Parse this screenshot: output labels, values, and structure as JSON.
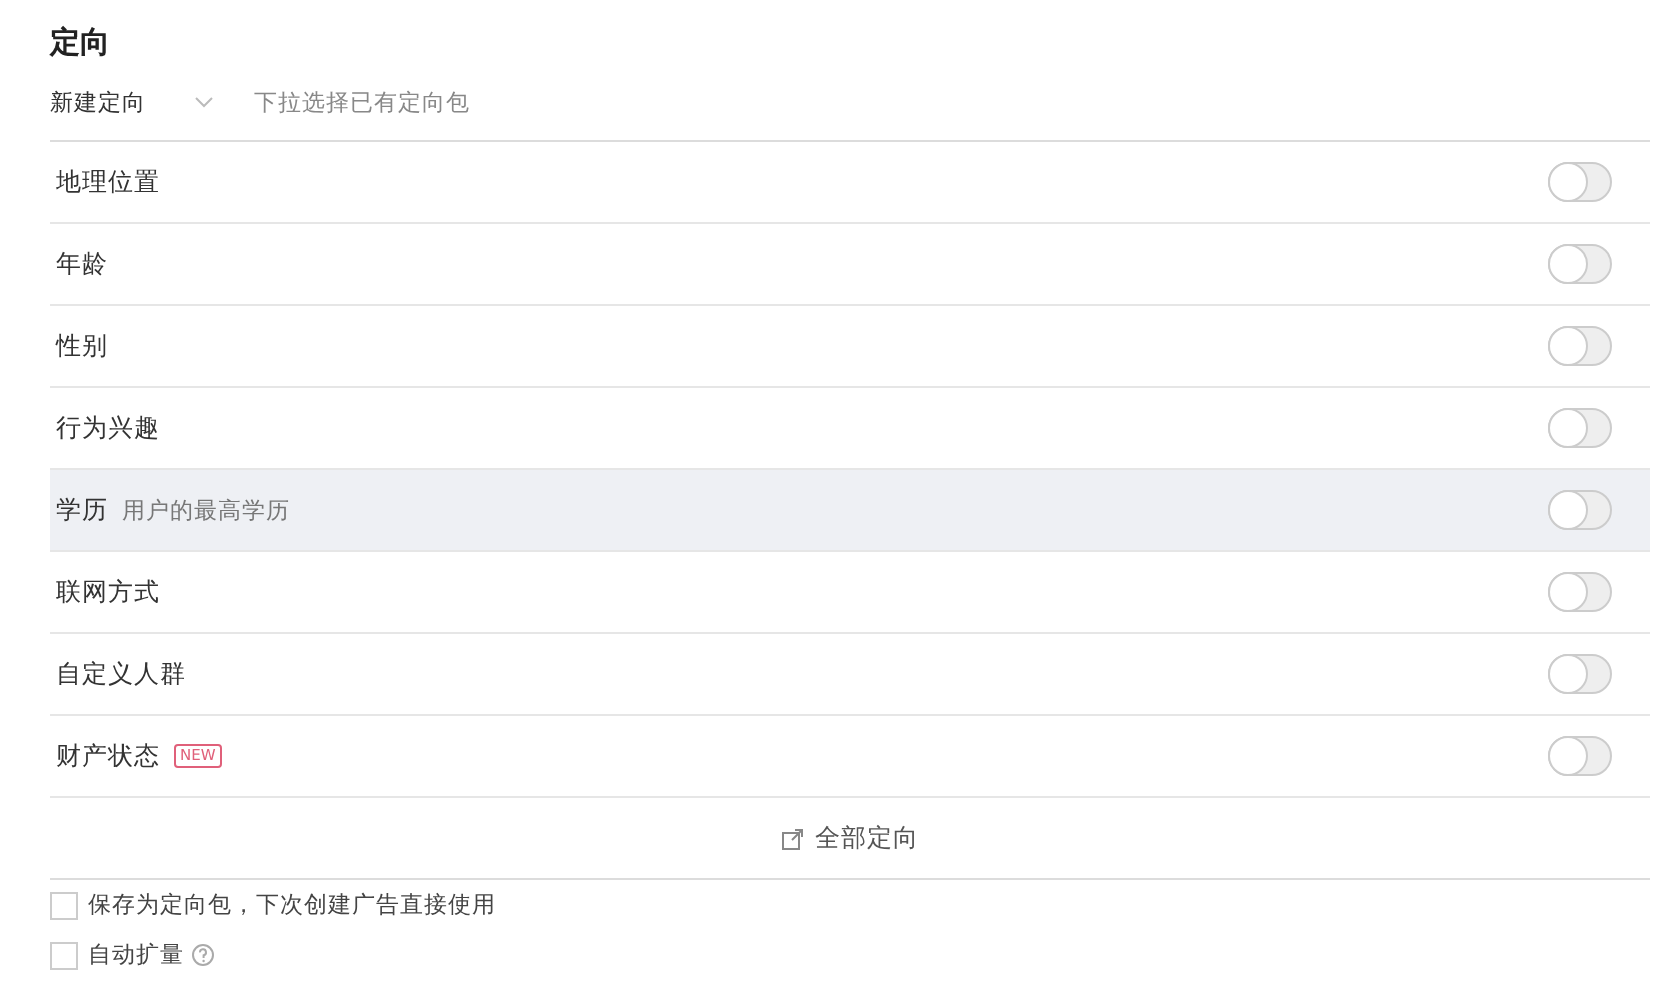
{
  "title": "定向",
  "package_select": {
    "value": "新建定向",
    "placeholder": "下拉选择已有定向包"
  },
  "rows": [
    {
      "label": "地理位置",
      "on": false,
      "hovered": false
    },
    {
      "label": "年龄",
      "on": false,
      "hovered": false
    },
    {
      "label": "性别",
      "on": false,
      "hovered": false
    },
    {
      "label": "行为兴趣",
      "on": false,
      "hovered": false
    },
    {
      "label": "学历",
      "hint": "用户的最高学历",
      "on": false,
      "hovered": true
    },
    {
      "label": "联网方式",
      "on": false,
      "hovered": false
    },
    {
      "label": "自定义人群",
      "on": false,
      "hovered": false
    },
    {
      "label": "财产状态",
      "badge": "NEW",
      "on": false,
      "hovered": false
    }
  ],
  "expand_all": "全部定向",
  "options": [
    {
      "label": "保存为定向包，下次创建广告直接使用",
      "checked": false
    },
    {
      "label": "自动扩量",
      "checked": false,
      "help": true
    }
  ]
}
